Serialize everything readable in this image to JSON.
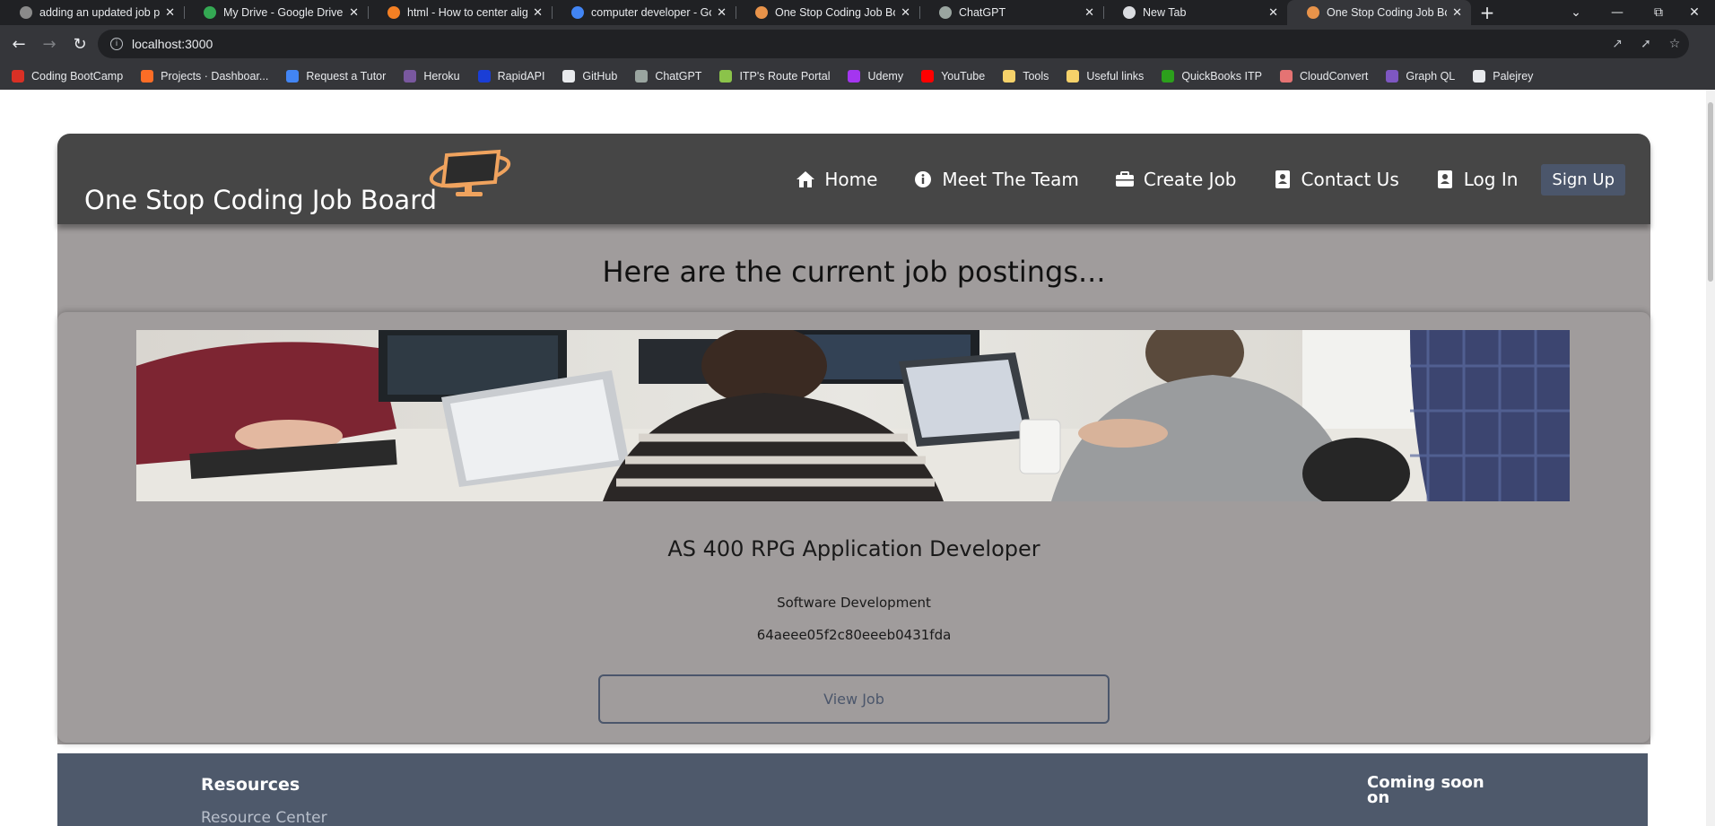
{
  "browser": {
    "tabs": [
      {
        "title": "adding an updated job pic",
        "icon_color": "#8a8a8a",
        "active": false
      },
      {
        "title": "My Drive - Google Drive",
        "icon_color": "#34a853",
        "active": false
      },
      {
        "title": "html - How to center align",
        "icon_color": "#f48024",
        "active": false
      },
      {
        "title": "computer developer - Goo",
        "icon_color": "#4285f4",
        "active": false
      },
      {
        "title": "One Stop Coding Job Boar",
        "icon_color": "#e8934a",
        "active": false
      },
      {
        "title": "ChatGPT",
        "icon_color": "#9aa5a0",
        "active": false
      },
      {
        "title": "New Tab",
        "icon_color": "#dadce0",
        "active": false
      },
      {
        "title": "One Stop Coding Job Boar",
        "icon_color": "#e8934a",
        "active": true
      }
    ],
    "new_tab_label": "+",
    "url": "localhost:3000",
    "bookmarks": [
      {
        "label": "Coding BootCamp",
        "icon_color": "#d93025"
      },
      {
        "label": "Projects · Dashboar...",
        "icon_color": "#fc6d26"
      },
      {
        "label": "Request a Tutor",
        "icon_color": "#4285f4"
      },
      {
        "label": "Heroku",
        "icon_color": "#79589f"
      },
      {
        "label": "RapidAPI",
        "icon_color": "#1a3ed6"
      },
      {
        "label": "GitHub",
        "icon_color": "#e8eaed"
      },
      {
        "label": "ChatGPT",
        "icon_color": "#9aa5a0"
      },
      {
        "label": "ITP's Route Portal",
        "icon_color": "#8bc34a"
      },
      {
        "label": "Udemy",
        "icon_color": "#a435f0"
      },
      {
        "label": "YouTube",
        "icon_color": "#ff0000"
      },
      {
        "label": "Tools",
        "icon_color": "#f6d26a"
      },
      {
        "label": "Useful links",
        "icon_color": "#f6d26a"
      },
      {
        "label": "QuickBooks ITP",
        "icon_color": "#2ca01c"
      },
      {
        "label": "CloudConvert",
        "icon_color": "#e57373"
      },
      {
        "label": "Graph QL",
        "icon_color": "#7e57c2"
      },
      {
        "label": "Palejrey",
        "icon_color": "#e8eaed"
      }
    ]
  },
  "site": {
    "brand": "One Stop Coding Job Board",
    "nav": [
      {
        "label": "Home",
        "icon": "home-icon"
      },
      {
        "label": "Meet The Team",
        "icon": "info-icon"
      },
      {
        "label": "Create Job",
        "icon": "briefcase-icon"
      },
      {
        "label": "Contact Us",
        "icon": "contact-card-icon"
      },
      {
        "label": "Log In",
        "icon": "login-icon"
      }
    ],
    "signup": "Sign Up",
    "heading": "Here are the current job postings...",
    "job": {
      "title": "AS 400 RPG Application Developer",
      "category": "Software Development",
      "id": "64aeee05f2c80eeeb0431fda",
      "button": "View Job"
    },
    "footer": {
      "resources_heading": "Resources",
      "resources_link": "Resource Center",
      "coming_soon": "Coming soon on"
    }
  },
  "colors": {
    "header_bg": "#464646",
    "content_bg": "#a09c9c",
    "accent": "#4b566b",
    "footer_bg": "#4e596b",
    "logo_orange": "#f0a35e"
  }
}
